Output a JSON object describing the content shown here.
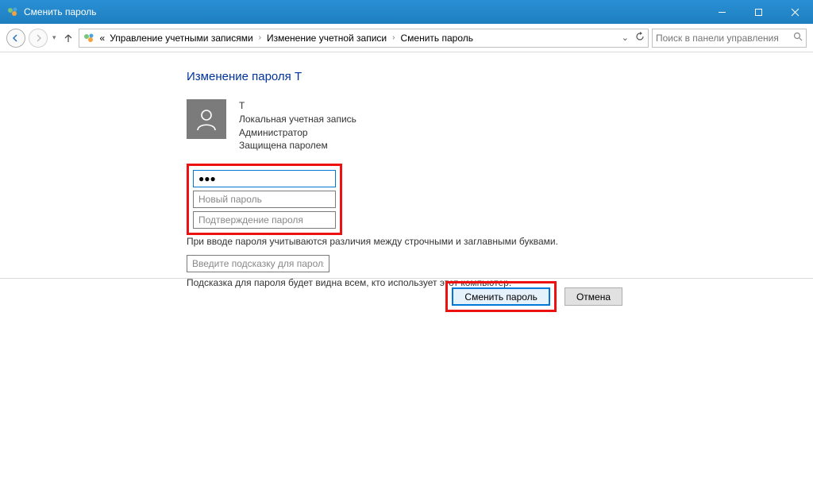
{
  "window": {
    "title": "Сменить пароль"
  },
  "breadcrumb": {
    "prefix": "«",
    "items": [
      "Управление учетными записями",
      "Изменение учетной записи",
      "Сменить пароль"
    ]
  },
  "search": {
    "placeholder": "Поиск в панели управления"
  },
  "heading": "Изменение пароля T",
  "account": {
    "name": "T",
    "type": "Локальная учетная запись",
    "role": "Администратор",
    "protection": "Защищена паролем"
  },
  "fields": {
    "current_value": "●●●",
    "new_placeholder": "Новый пароль",
    "confirm_placeholder": "Подтверждение пароля",
    "case_hint": "При вводе пароля учитываются различия между строчными и заглавными буквами.",
    "hint_placeholder": "Введите подсказку для пароля",
    "hint_below": "Подсказка для пароля будет видна всем, кто использует этот компьютер."
  },
  "buttons": {
    "submit": "Сменить пароль",
    "cancel": "Отмена"
  }
}
